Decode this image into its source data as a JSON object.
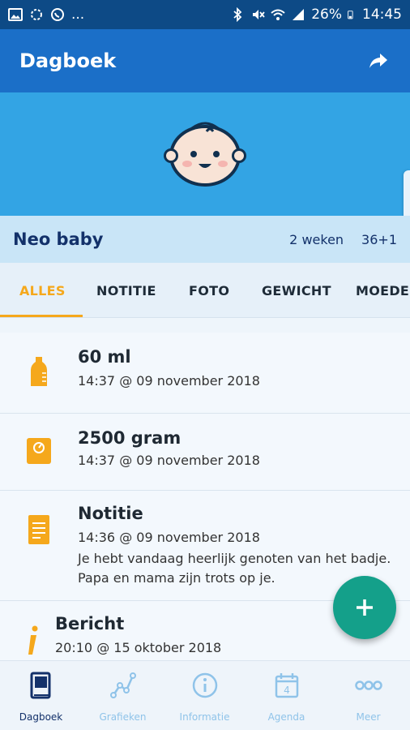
{
  "status_bar": {
    "battery": "26%",
    "time": "14:45",
    "more": "..."
  },
  "app_bar": {
    "title": "Dagboek"
  },
  "profile": {
    "name": "Neo baby",
    "age": "2 weken",
    "gestation": "36+1"
  },
  "tabs": [
    {
      "label": "ALLES",
      "active": true
    },
    {
      "label": "NOTITIE",
      "active": false
    },
    {
      "label": "FOTO",
      "active": false
    },
    {
      "label": "GEWICHT",
      "active": false
    },
    {
      "label": "MOEDE",
      "active": false
    }
  ],
  "entries": [
    {
      "icon": "bottle-icon",
      "title": "60 ml",
      "subtitle": "14:37 @ 09 november 2018"
    },
    {
      "icon": "scale-icon",
      "title": "2500 gram",
      "subtitle": "14:37 @ 09 november 2018"
    },
    {
      "icon": "note-icon",
      "title": "Notitie",
      "subtitle": "14:36 @ 09 november 2018",
      "body_line1": "Je hebt vandaag heerlijk genoten van het badje.",
      "body_line2": "Papa en mama zijn trots op je."
    },
    {
      "icon": "info-icon",
      "title": "Bericht",
      "subtitle": "20:10 @ 15 oktober 2018"
    }
  ],
  "fab": {
    "symbol": "+"
  },
  "bottom_nav": [
    {
      "label": "Dagboek",
      "icon": "book-icon",
      "active": true
    },
    {
      "label": "Grafieken",
      "icon": "chart-icon",
      "active": false
    },
    {
      "label": "Informatie",
      "icon": "info-circle-icon",
      "active": false
    },
    {
      "label": "Agenda",
      "icon": "calendar-icon",
      "active": false,
      "day": "4"
    },
    {
      "label": "Meer",
      "icon": "more-icon",
      "active": false
    }
  ],
  "colors": {
    "status_bar": "#0d4a86",
    "app_bar": "#1b6fc8",
    "banner": "#33a4e4",
    "profile_row": "#c9e5f7",
    "accent": "#f5a81c",
    "fab": "#14a08a",
    "nav_active": "#13316a",
    "nav_inactive": "#8fc3e9"
  }
}
